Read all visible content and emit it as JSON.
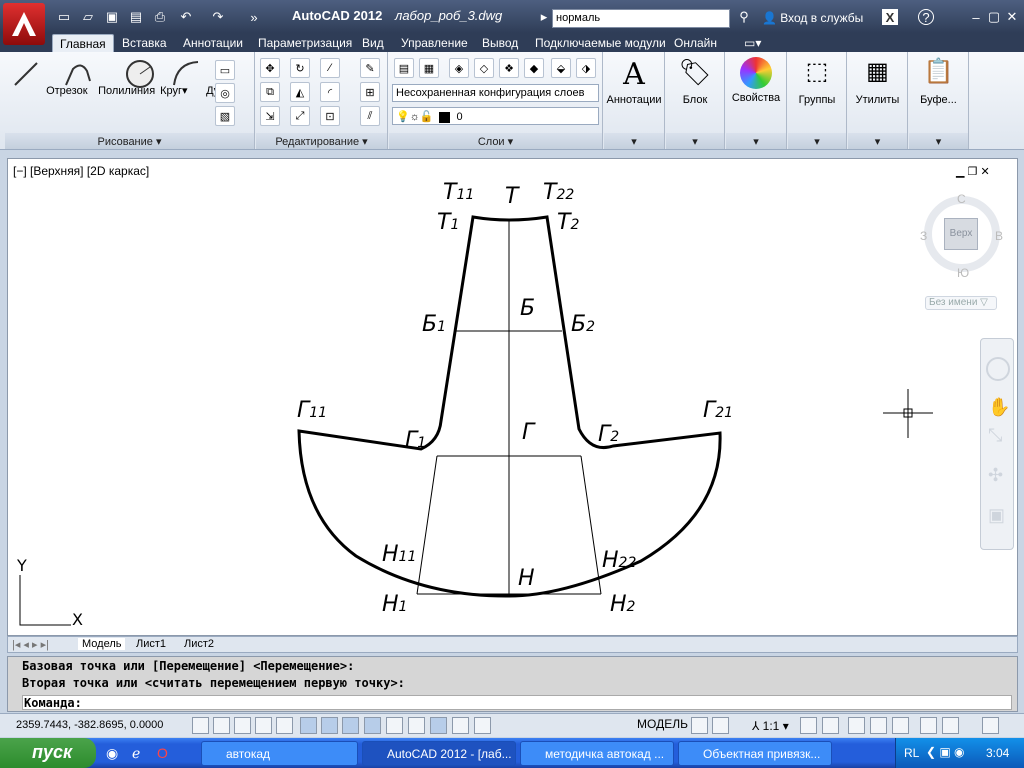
{
  "window": {
    "app_title": "AutoCAD 2012",
    "file_title": "лабор_роб_3.dwg",
    "search_value": "нормаль",
    "login_label": "Вход в службы"
  },
  "ribbon_tabs": [
    "Главная",
    "Вставка",
    "Аннотации",
    "Параметризация",
    "Вид",
    "Управление",
    "Вывод",
    "Подключаемые модули",
    "Онлайн"
  ],
  "draw_panel": {
    "title": "Рисование",
    "tools": [
      "Отрезок",
      "Полилиния",
      "Круг",
      "Дуга"
    ]
  },
  "modify_panel": {
    "title": "Редактирование"
  },
  "layers_panel": {
    "title": "Слои",
    "layer_state": "Несохраненная конфигурация слоев",
    "current_layer": "0"
  },
  "big_panels": [
    "Аннотации",
    "Блок",
    "Свойства",
    "Группы",
    "Утилиты",
    "Буфе..."
  ],
  "viewport": {
    "label": "[−] [Верхняя] [2D каркас]",
    "viewcube": {
      "top": "Верх",
      "north": "С",
      "south": "Ю",
      "west": "З",
      "east": "В"
    },
    "ucs_button": "Без имени",
    "ucs_x": "X",
    "ucs_y": "Y"
  },
  "drawing_labels": {
    "T11": {
      "main": "Т",
      "sub": "11"
    },
    "T": {
      "main": "Т",
      "sub": ""
    },
    "T22": {
      "main": "Т",
      "sub": "22"
    },
    "T1": {
      "main": "Т",
      "sub": "1"
    },
    "T2": {
      "main": "Т",
      "sub": "2"
    },
    "B": {
      "main": "Б",
      "sub": ""
    },
    "B1": {
      "main": "Б",
      "sub": "1"
    },
    "B2": {
      "main": "Б",
      "sub": "2"
    },
    "G11": {
      "main": "Г",
      "sub": "11"
    },
    "G21": {
      "main": "Г",
      "sub": "21"
    },
    "G": {
      "main": "Г",
      "sub": ""
    },
    "G1": {
      "main": "Г",
      "sub": "1"
    },
    "G2": {
      "main": "Г",
      "sub": "2"
    },
    "H11": {
      "main": "Н",
      "sub": "11"
    },
    "H22": {
      "main": "Н",
      "sub": "22"
    },
    "H": {
      "main": "Н",
      "sub": ""
    },
    "H1": {
      "main": "Н",
      "sub": "1"
    },
    "H2": {
      "main": "Н",
      "sub": "2"
    }
  },
  "layout_tabs": [
    "Модель",
    "Лист1",
    "Лист2"
  ],
  "command": {
    "line1": "Базовая точка или [Перемещение] <Перемещение>:",
    "line2": "Вторая точка или <считать перемещением первую точку>:",
    "prompt": "Команда:"
  },
  "status": {
    "coords": "2359.7443, -382.8695, 0.0000",
    "model": "МОДЕЛЬ",
    "scale": "1:1"
  },
  "taskbar": {
    "start": "пуск",
    "tasks": [
      "автокад",
      "AutoCAD 2012 - [лаб...",
      "методичка автокад ...",
      "Объектная привязк..."
    ],
    "lang": "RL",
    "clock": "3:04"
  }
}
